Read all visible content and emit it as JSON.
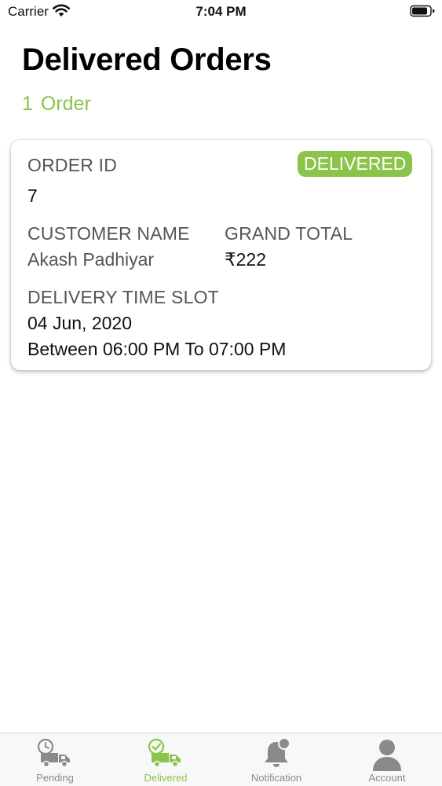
{
  "status_bar": {
    "carrier": "Carrier",
    "time": "7:04 PM",
    "wifi_icon": "wifi-icon",
    "battery_icon": "battery-icon"
  },
  "header": {
    "title": "Delivered Orders",
    "count_number": "1",
    "count_label": "Order"
  },
  "order": {
    "order_id_label": "ORDER ID",
    "order_id": "7",
    "status_badge": "DELIVERED",
    "customer_name_label": "CUSTOMER NAME",
    "customer_name": "Akash Padhiyar",
    "grand_total_label": "GRAND TOTAL",
    "grand_total": "₹222",
    "time_slot_label": "DELIVERY TIME SLOT",
    "delivery_date": "04 Jun, 2020",
    "delivery_window": "Between 06:00 PM To 07:00 PM"
  },
  "tabs": [
    {
      "label": "Pending",
      "icon": "pending-truck-clock-icon",
      "active": false
    },
    {
      "label": "Delivered",
      "icon": "delivered-truck-check-icon",
      "active": true
    },
    {
      "label": "Notification",
      "icon": "bell-icon",
      "active": false
    },
    {
      "label": "Account",
      "icon": "user-icon",
      "active": false
    }
  ],
  "colors": {
    "accent": "#8cc34a",
    "inactive_tab": "#8a8a8a",
    "label_gray": "#555555"
  }
}
